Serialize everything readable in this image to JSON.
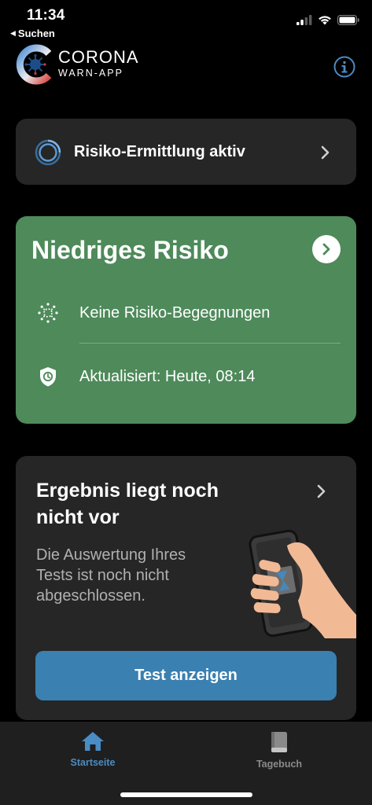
{
  "status_bar": {
    "time": "11:34",
    "back_label": "Suchen",
    "icons": [
      "cellular-signal-icon",
      "wifi-icon",
      "battery-icon"
    ]
  },
  "header": {
    "logo_title": "CORONA",
    "logo_subtitle": "WARN-APP",
    "info_icon": "info-icon"
  },
  "risk_detection": {
    "label": "Risiko-Ermittlung aktiv",
    "icon": "exposure-logging-icon"
  },
  "risk_card": {
    "title": "Niedriges Risiko",
    "color": "#4e8a5a",
    "rows": [
      {
        "icon": "virus-icon",
        "text": "Keine Risiko-Begegnungen"
      },
      {
        "icon": "shield-clock-icon",
        "text": "Aktualisiert: Heute, 08:14"
      }
    ]
  },
  "test_card": {
    "title": "Ergebnis liegt noch nicht vor",
    "description": "Die Auswertung Ihres Tests ist noch nicht abgeschlossen.",
    "button_label": "Test anzeigen",
    "button_color": "#3a80b1"
  },
  "tab_bar": {
    "tabs": [
      {
        "label": "Startseite",
        "icon": "home-icon",
        "active": true
      },
      {
        "label": "Tagebuch",
        "icon": "book-icon",
        "active": false
      }
    ],
    "accent": "#4a8cc4"
  }
}
